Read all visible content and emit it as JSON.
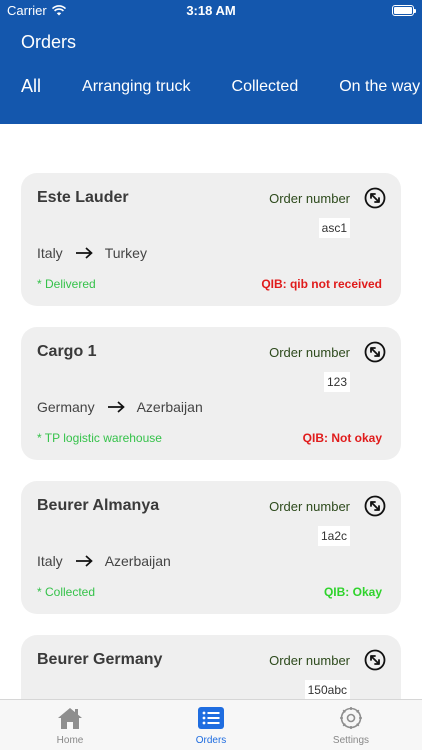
{
  "status_bar": {
    "carrier": "Carrier",
    "time": "3:18 AM"
  },
  "header": {
    "title": "Orders",
    "tabs": [
      "All",
      "Arranging truck",
      "Collected",
      "On the way"
    ]
  },
  "orders": [
    {
      "name": "Este Lauder",
      "order_label": "Order number",
      "order_number": "asc1",
      "from": "Italy",
      "to": "Turkey",
      "status": "* Delivered",
      "qib": "QIB: qib not received",
      "qib_color": "#e01b1b"
    },
    {
      "name": "Cargo 1",
      "order_label": "Order number",
      "order_number": "123",
      "from": "Germany",
      "to": "Azerbaijan",
      "status": "* TP logistic warehouse",
      "qib": "QIB: Not okay",
      "qib_color": "#e01b1b"
    },
    {
      "name": "Beurer Almanya",
      "order_label": "Order number",
      "order_number": "1a2c",
      "from": "Italy",
      "to": "Azerbaijan",
      "status": "* Collected",
      "qib": "QIB: Okay",
      "qib_color": "#2fd32c"
    },
    {
      "name": "Beurer Germany",
      "order_label": "Order number",
      "order_number": "150abc",
      "from": "",
      "to": "",
      "status": "",
      "qib": "",
      "qib_color": "#e01b1b"
    }
  ],
  "tabbar": {
    "items": [
      {
        "label": "Home",
        "icon": "home-icon"
      },
      {
        "label": "Orders",
        "icon": "list-icon"
      },
      {
        "label": "Settings",
        "icon": "gear-icon"
      }
    ],
    "active_color": "#1f6de0",
    "inactive_color": "#888888"
  }
}
